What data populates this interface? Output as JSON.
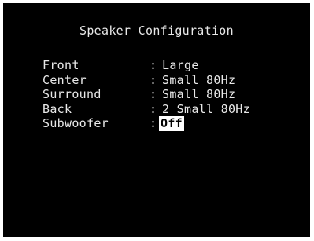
{
  "menu": {
    "title": "Speaker Configuration",
    "items": [
      {
        "label": "Front",
        "separator": ":",
        "value": "Large"
      },
      {
        "label": "Center",
        "separator": ":",
        "value": "Small 80Hz"
      },
      {
        "label": "Surround",
        "separator": ":",
        "value": "Small 80Hz"
      },
      {
        "label": "Back",
        "separator": ":",
        "value": "2 Small 80Hz"
      },
      {
        "label": "Subwoofer",
        "separator": ":",
        "value": "Off"
      }
    ],
    "selected_item": "Subwoofer"
  },
  "colors": {
    "background": "#000000",
    "text": "#e8e8e8",
    "highlight_bg": "#ffffff",
    "highlight_text": "#000000"
  }
}
